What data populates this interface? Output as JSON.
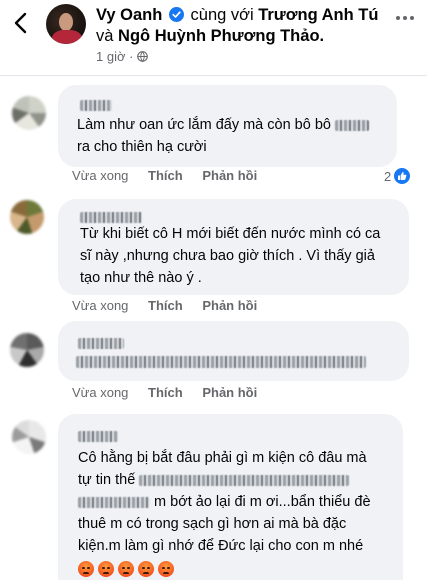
{
  "post": {
    "author": "Vy Oanh",
    "with_text": "cùng với",
    "tagged_1": "Trương Anh Tú",
    "and_text": "và",
    "tagged_2": "Ngô Huỳnh Phương Thảo.",
    "time": "1 giờ ·"
  },
  "comments": [
    {
      "line1": "Làm như oan ức lắm đấy mà còn bô bô",
      "line2": "ra cho thiên hạ cười",
      "time": "Vừa xong",
      "like": "Thích",
      "reply": "Phản hồi",
      "reaction_count": "2"
    },
    {
      "line1": "Từ khi biết cô H mới biết đến nước mình có ca",
      "line2": "sĩ này ,nhưng chưa bao giờ thích . Vì thấy giả",
      "line3": "tạo như thê nào ý .",
      "time": "Vừa xong",
      "like": "Thích",
      "reply": "Phản hồi"
    },
    {
      "time": "Vừa xong",
      "like": "Thích",
      "reply": "Phản hồi"
    },
    {
      "line1": "Cô hằng bị bắt đâu phải gì m kiện cô đâu mà",
      "line2": "tự tin thế",
      "line3": "m bớt ảo lại đi m ơi...bẩn thiểu đè",
      "line4": "thuê m có trong sạch gì hơn ai mà bà đặc",
      "line5": "kiện.m làm gì nhớ để Đức lại cho con m nhé"
    }
  ],
  "colors": {
    "link_blue": "#1877f2",
    "meta_gray": "#65676b",
    "bubble_bg": "#f0f2f5"
  },
  "icons": [
    "back-arrow-icon",
    "verified-icon",
    "globe-icon",
    "more-icon",
    "like-icon",
    "angry-emoji-icon"
  ]
}
